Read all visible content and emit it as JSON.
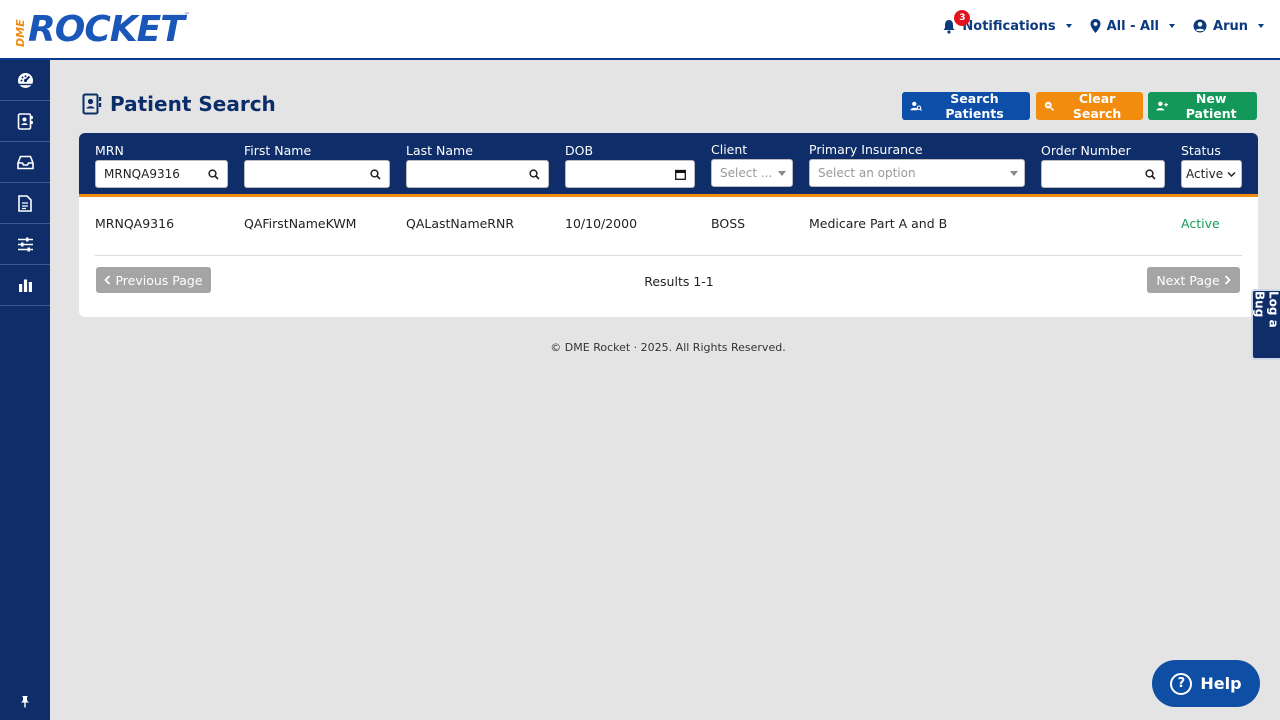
{
  "brand": {
    "prefix": "DME",
    "name": "ROCKET",
    "tm": "™"
  },
  "nav": {
    "notifications_label": "Notifications",
    "notifications_count": "3",
    "location_label": "All - All",
    "user_label": "Arun"
  },
  "sidebar": {
    "items": [
      {
        "icon": "dashboard-icon"
      },
      {
        "icon": "patient-card-icon"
      },
      {
        "icon": "inbox-icon"
      },
      {
        "icon": "document-icon"
      },
      {
        "icon": "sliders-icon"
      },
      {
        "icon": "bar-chart-icon"
      }
    ],
    "pin_icon": "pin-icon"
  },
  "page": {
    "title": "Patient Search",
    "buttons": {
      "search": "Search Patients",
      "clear": "Clear Search",
      "new": "New Patient"
    }
  },
  "filters": {
    "mrn": {
      "label": "MRN",
      "value": "MRNQA9316"
    },
    "first_name": {
      "label": "First Name",
      "value": ""
    },
    "last_name": {
      "label": "Last Name",
      "value": ""
    },
    "dob": {
      "label": "DOB",
      "value": ""
    },
    "client": {
      "label": "Client",
      "placeholder": "Select ..."
    },
    "primary_insurance": {
      "label": "Primary Insurance",
      "placeholder": "Select an option"
    },
    "order_number": {
      "label": "Order Number",
      "value": ""
    },
    "status": {
      "label": "Status",
      "value": "Active"
    }
  },
  "results": {
    "rows": [
      {
        "mrn": "MRNQA9316",
        "first_name": "QAFirstNameKWM",
        "last_name": "QALastNameRNR",
        "dob": "10/10/2000",
        "client": "BOSS",
        "primary_insurance": "Medicare Part A and B",
        "order_number": "",
        "status": "Active"
      }
    ],
    "summary": "Results 1-1",
    "prev_label": "Previous Page",
    "next_label": "Next Page"
  },
  "footer": {
    "text": "© DME Rocket  ·  2025. All Rights Reserved."
  },
  "log_bug": "Log a Bug",
  "help": {
    "label": "Help",
    "glyph": "?"
  },
  "colors": {
    "navy": "#0e2d69",
    "brand_blue": "#1a57b8",
    "orange": "#f28c0f",
    "green": "#13985a",
    "badge_red": "#e0141e"
  }
}
